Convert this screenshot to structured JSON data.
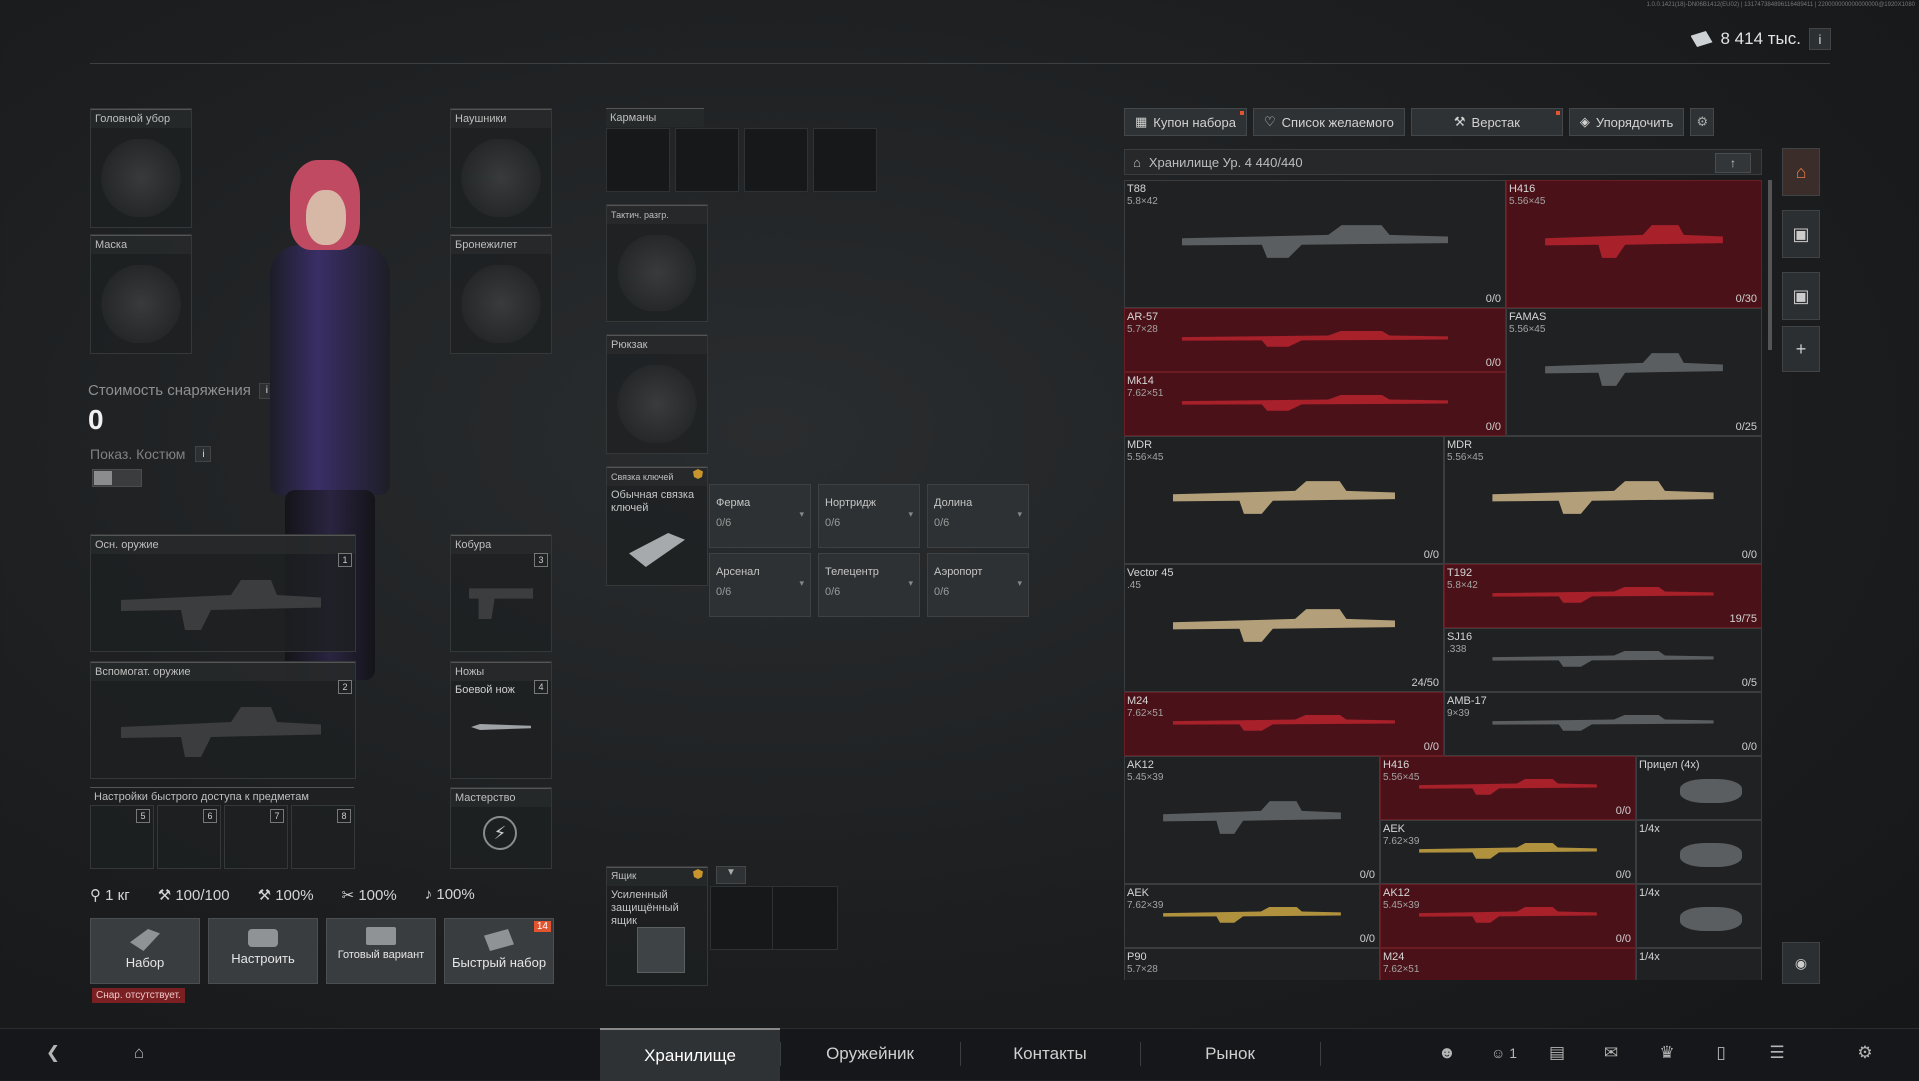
{
  "version_text": "1.0.0.1421(18)-DN06B1412(ЕU02) | 131747384896116489411 | 220000000000000000@1920X1080",
  "currency": {
    "amount": "8 414 тыс.",
    "info": "i"
  },
  "equipment": {
    "headwear": "Головной убор",
    "headphones": "Наушники",
    "mask": "Маска",
    "armor": "Бронежилет",
    "gear_cost_label": "Стоимость снаряжения",
    "gear_cost_value": "0",
    "show_costume": "Показ. Костюм",
    "primary_weapon": "Осн. оружие",
    "primary_num": "1",
    "holster": "Кобура",
    "holster_num": "3",
    "secondary_weapon": "Вспомогат. оружие",
    "secondary_num": "2",
    "knives": "Ножы",
    "knife_num": "4",
    "knife_item": "Боевой нож",
    "quick_access": "Настройки быстрого доступа к предметам",
    "quick_nums": [
      "5",
      "6",
      "7",
      "8"
    ],
    "mastery": "Мастерство"
  },
  "stats": {
    "weight": "1 кг",
    "durability": "100/100",
    "stat2": "100%",
    "stat3": "100%",
    "stat4": "100%"
  },
  "actions": {
    "kit": "Набор",
    "configure": "Настроить",
    "ready": "Готовый вариант",
    "quick_kit": "Быстрый набор",
    "quick_kit_badge": "14",
    "warning": "Снар. отсутствует."
  },
  "middle": {
    "pockets": "Карманы",
    "tactical": "Тактич. разгр.",
    "backpack": "Рюкзак",
    "keychain": "Связка ключей",
    "keychain_item": "Обычная связка ключей",
    "keys": [
      {
        "name": "Ферма",
        "value": "0/6"
      },
      {
        "name": "Нортридж",
        "value": "0/6"
      },
      {
        "name": "Долина",
        "value": "0/6"
      },
      {
        "name": "Арсенал",
        "value": "0/6"
      },
      {
        "name": "Телецентр",
        "value": "0/6"
      },
      {
        "name": "Аэропорт",
        "value": "0/6"
      }
    ],
    "box": "Ящик",
    "box_item": "Усиленный защищённый ящик"
  },
  "toolbar": {
    "coupon": "Купон набора",
    "wishlist": "Список желаемого",
    "workbench": "Верстак",
    "sort": "Упорядочить"
  },
  "stash": {
    "title": "Хранилище Ур. 4 440/440",
    "items": [
      {
        "name": "T88",
        "cal": "5.8×42",
        "count": "0/0"
      },
      {
        "name": "H416",
        "cal": "5.56×45",
        "count": "0/30"
      },
      {
        "name": "AR-57",
        "cal": "5.7×28",
        "count": "0/0"
      },
      {
        "name": "FAMAS",
        "cal": "5.56×45",
        "count": "0/25"
      },
      {
        "name": "Mk14",
        "cal": "7.62×51",
        "count": "0/0"
      },
      {
        "name": "MDR",
        "cal": "5.56×45",
        "count": "0/0"
      },
      {
        "name": "MDR",
        "cal": "5.56×45",
        "count": "0/0"
      },
      {
        "name": "Vector 45",
        "cal": ".45",
        "count": "24/50"
      },
      {
        "name": "T192",
        "cal": "5.8×42",
        "count": "19/75"
      },
      {
        "name": "SJ16",
        "cal": ".338",
        "count": "0/5"
      },
      {
        "name": "M24",
        "cal": "7.62×51",
        "count": "0/0"
      },
      {
        "name": "AMB-17",
        "cal": "9×39",
        "count": "0/0"
      },
      {
        "name": "AK12",
        "cal": "5.45×39",
        "count": "0/0"
      },
      {
        "name": "H416",
        "cal": "5.56×45",
        "count": "0/0"
      },
      {
        "name": "Прицел (4x)",
        "cal": "",
        "count": ""
      },
      {
        "name": "AEK",
        "cal": "7.62×39",
        "count": "0/0"
      },
      {
        "name": "1/4x",
        "cal": "",
        "count": ""
      },
      {
        "name": "AEK",
        "cal": "7.62×39",
        "count": "0/0"
      },
      {
        "name": "AK12",
        "cal": "5.45×39",
        "count": "0/0"
      },
      {
        "name": "1/4x",
        "cal": "",
        "count": ""
      },
      {
        "name": "P90",
        "cal": "5.7×28",
        "count": ""
      },
      {
        "name": "M24",
        "cal": "7.62×51",
        "count": ""
      },
      {
        "name": "1/4x",
        "cal": "",
        "count": ""
      }
    ]
  },
  "bottom_nav": {
    "tabs": [
      "Хранилище",
      "Оружейник",
      "Контакты",
      "Рынок"
    ],
    "friends_count": "1"
  }
}
